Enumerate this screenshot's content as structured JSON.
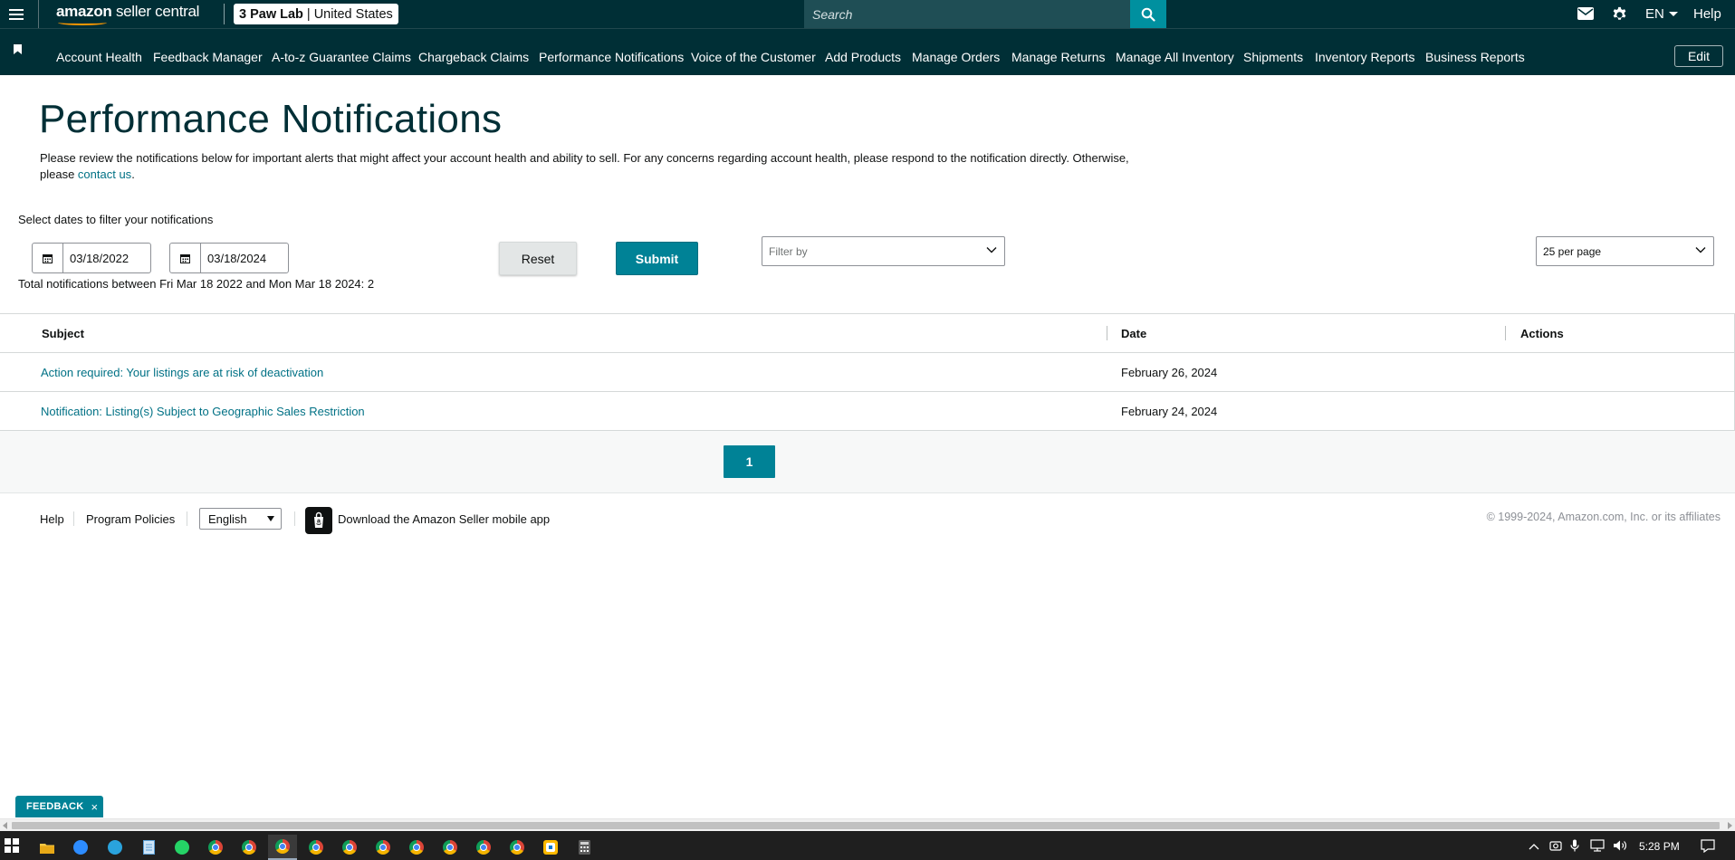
{
  "topbar": {
    "logo_brand": "amazon",
    "logo_product": "seller central",
    "store_name": "3 Paw Lab",
    "store_separator": "|",
    "store_region": "United States",
    "search_placeholder": "Search",
    "language": "EN",
    "help": "Help"
  },
  "nav": {
    "items": [
      "Account Health",
      "Feedback Manager",
      "A-to-z Guarantee Claims",
      "Chargeback Claims",
      "Performance Notifications",
      "Voice of the Customer",
      "Add Products",
      "Manage Orders",
      "Manage Returns",
      "Manage All Inventory",
      "Shipments",
      "Inventory Reports",
      "Business Reports"
    ],
    "edit": "Edit"
  },
  "page": {
    "title": "Performance Notifications",
    "intro_text": "Please review the notifications below for important alerts that might affect your account health and ability to sell. For any concerns regarding account health, please respond to the notification directly. Otherwise, please ",
    "intro_link": "contact us",
    "intro_end": "."
  },
  "filters": {
    "label": "Select dates to filter your notifications",
    "start_date": "03/18/2022",
    "end_date": "03/18/2024",
    "reset": "Reset",
    "submit": "Submit",
    "filter_by_placeholder": "Filter by",
    "per_page": "25 per page",
    "total_text": "Total notifications between Fri Mar 18 2022 and Mon Mar 18 2024: 2"
  },
  "table": {
    "headers": {
      "subject": "Subject",
      "date": "Date",
      "actions": "Actions"
    },
    "rows": [
      {
        "subject": "Action required: Your listings are at risk of deactivation",
        "date": "February 26, 2024"
      },
      {
        "subject": "Notification: Listing(s) Subject to Geographic Sales Restriction",
        "date": "February 24, 2024"
      }
    ]
  },
  "pagination": {
    "current_page": "1"
  },
  "footer": {
    "help": "Help",
    "program_policies": "Program Policies",
    "language": "English",
    "app_download": "Download the Amazon Seller mobile app",
    "copyright": "© 1999-2024, Amazon.com, Inc. or its affiliates"
  },
  "feedback": {
    "label": "FEEDBACK",
    "close": "×"
  },
  "taskbar": {
    "time": "5:28 PM"
  },
  "colors": {
    "header_bg": "#002f36",
    "accent": "#008296",
    "link": "#007185"
  }
}
